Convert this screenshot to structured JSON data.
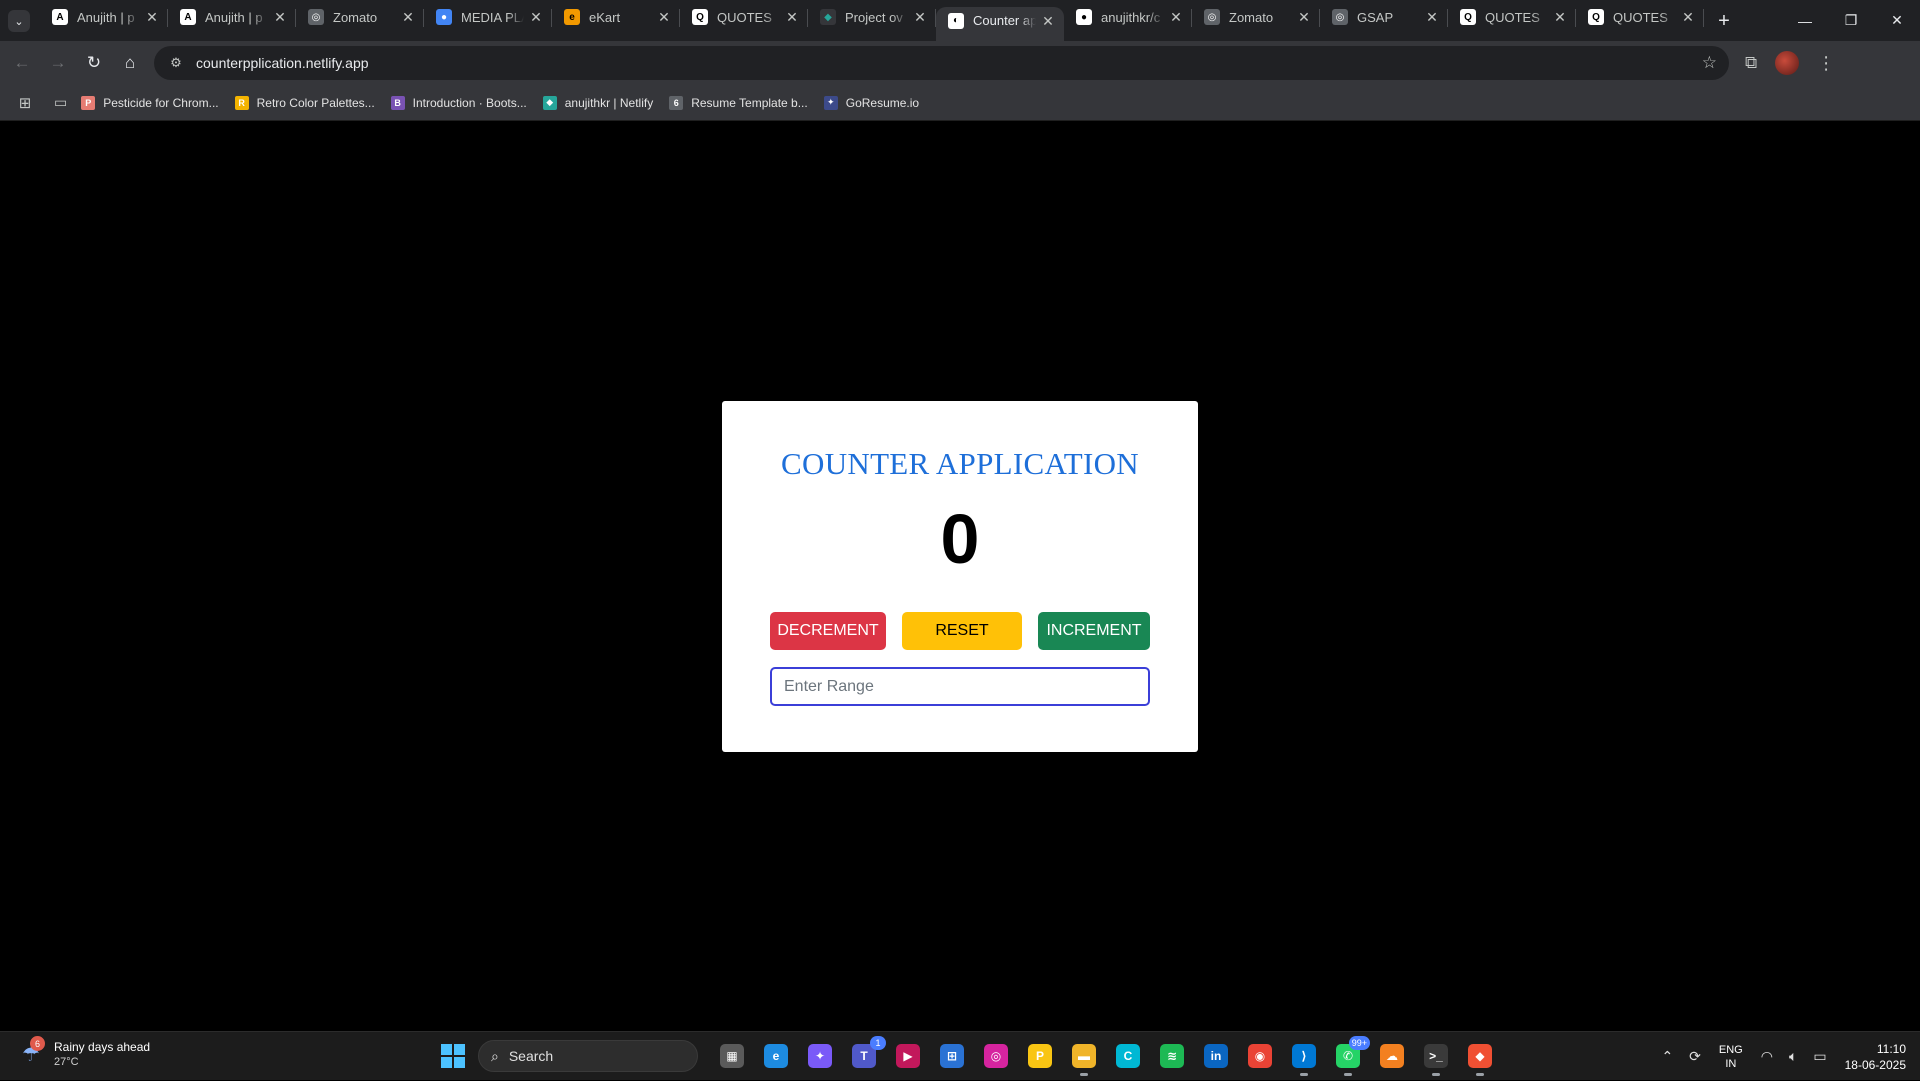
{
  "browser": {
    "tabs": [
      {
        "title": "Anujith | p",
        "favicon": "A",
        "fav_bg": "#ffffff",
        "fav_fg": "#000000",
        "active": false
      },
      {
        "title": "Anujith | p",
        "favicon": "A",
        "fav_bg": "#ffffff",
        "fav_fg": "#000000",
        "active": false
      },
      {
        "title": "Zomato",
        "favicon": "◎",
        "fav_bg": "#5f6368",
        "fav_fg": "#ffffff",
        "active": false
      },
      {
        "title": "MEDIA PLA",
        "favicon": "●",
        "fav_bg": "#4285f4",
        "fav_fg": "#ffffff",
        "active": false
      },
      {
        "title": "eKart",
        "favicon": "e",
        "fav_bg": "#f29900",
        "fav_fg": "#000000",
        "active": false
      },
      {
        "title": "QUOTES",
        "favicon": "Q",
        "fav_bg": "#ffffff",
        "fav_fg": "#000000",
        "active": false
      },
      {
        "title": "Project ov",
        "favicon": "◆",
        "fav_bg": "#35363a",
        "fav_fg": "#26a69a",
        "active": false
      },
      {
        "title": "Counter ap",
        "favicon": "◐",
        "fav_bg": "#ffffff",
        "fav_fg": "#000000",
        "active": true
      },
      {
        "title": "anujithkr/c",
        "favicon": "●",
        "fav_bg": "#ffffff",
        "fav_fg": "#000000",
        "active": false
      },
      {
        "title": "Zomato",
        "favicon": "◎",
        "fav_bg": "#5f6368",
        "fav_fg": "#ffffff",
        "active": false
      },
      {
        "title": "GSAP",
        "favicon": "◎",
        "fav_bg": "#5f6368",
        "fav_fg": "#ffffff",
        "active": false
      },
      {
        "title": "QUOTES",
        "favicon": "Q",
        "fav_bg": "#ffffff",
        "fav_fg": "#000000",
        "active": false
      },
      {
        "title": "QUOTES",
        "favicon": "Q",
        "fav_bg": "#ffffff",
        "fav_fg": "#000000",
        "active": false
      }
    ],
    "address": "counterpplication.netlify.app",
    "bookmarks": [
      {
        "label": "Pesticide for Chrom...",
        "favicon": "P",
        "color": "#e67c73"
      },
      {
        "label": "Retro Color Palettes...",
        "favicon": "R",
        "color": "#f4b400"
      },
      {
        "label": "Introduction · Boots...",
        "favicon": "B",
        "color": "#7952b3"
      },
      {
        "label": "anujithkr | Netlify",
        "favicon": "◆",
        "color": "#26a69a"
      },
      {
        "label": "Resume Template b...",
        "favicon": "6",
        "color": "#5f6368"
      },
      {
        "label": "GoResume.io",
        "favicon": "✦",
        "color": "#3c4a8a"
      }
    ]
  },
  "app": {
    "title": "COUNTER APPLICATION",
    "count": "0",
    "decrement_label": "DECREMENT",
    "reset_label": "RESET",
    "increment_label": "INCREMENT",
    "range_placeholder": "Enter Range",
    "colors": {
      "title": "#1e6fd9",
      "decrement": "#dc3545",
      "reset": "#ffc107",
      "increment": "#198754"
    }
  },
  "taskbar": {
    "weather_title": "Rainy days ahead",
    "weather_temp": "27°C",
    "weather_badge": "6",
    "search_label": "Search",
    "apps": [
      {
        "name": "task-view",
        "glyph": "▦",
        "bg": "#5a5a5a",
        "state": ""
      },
      {
        "name": "edge",
        "glyph": "e",
        "bg": "#1d8be0",
        "state": ""
      },
      {
        "name": "copilot",
        "glyph": "✦",
        "bg": "#7a5af8",
        "state": ""
      },
      {
        "name": "teams",
        "glyph": "T",
        "bg": "#5059c9",
        "state": "",
        "badge": "1"
      },
      {
        "name": "media-player",
        "glyph": "▶",
        "bg": "#c2185b",
        "state": ""
      },
      {
        "name": "store",
        "glyph": "⊞",
        "bg": "#2a72d4",
        "state": ""
      },
      {
        "name": "instagram",
        "glyph": "◎",
        "bg": "#d6249f",
        "state": ""
      },
      {
        "name": "pdf-reader",
        "glyph": "P",
        "bg": "#f9c513",
        "state": ""
      },
      {
        "name": "file-explorer",
        "glyph": "▬",
        "bg": "#f0b429",
        "state": "running"
      },
      {
        "name": "canva",
        "glyph": "C",
        "bg": "#00b8d4",
        "state": ""
      },
      {
        "name": "spotify",
        "glyph": "≋",
        "bg": "#1db954",
        "state": ""
      },
      {
        "name": "linkedin",
        "glyph": "in",
        "bg": "#0a66c2",
        "state": ""
      },
      {
        "name": "chrome",
        "glyph": "◉",
        "bg": "#ea4335",
        "state": "focused"
      },
      {
        "name": "vscode",
        "glyph": "⟩",
        "bg": "#0078d4",
        "state": "running"
      },
      {
        "name": "whatsapp",
        "glyph": "✆",
        "bg": "#25d366",
        "state": "running",
        "badge": "99+"
      },
      {
        "name": "cloud",
        "glyph": "☁",
        "bg": "#f38020",
        "state": ""
      },
      {
        "name": "terminal",
        "glyph": ">_",
        "bg": "#3a3a3a",
        "state": "running"
      },
      {
        "name": "git",
        "glyph": "◆",
        "bg": "#f05033",
        "state": "running"
      }
    ],
    "lang_1": "ENG",
    "lang_2": "IN",
    "time": "11:10",
    "date": "18-06-2025"
  }
}
